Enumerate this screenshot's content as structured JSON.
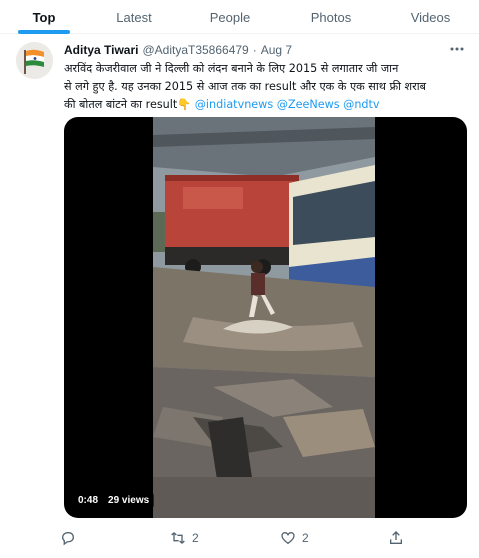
{
  "tabs": [
    {
      "label": "Top",
      "active": true
    },
    {
      "label": "Latest",
      "active": false
    },
    {
      "label": "People",
      "active": false
    },
    {
      "label": "Photos",
      "active": false
    },
    {
      "label": "Videos",
      "active": false
    }
  ],
  "tweet": {
    "display_name": "Aditya Tiwari",
    "handle": "@AdityaT35866479",
    "separator": "·",
    "date": "Aug 7",
    "text_line1": "अरविंद केजरीवाल जी ने दिल्ली को लंदन बनाने के लिए 2015 से लगातार जी जान",
    "text_line2": "से लगे हुए है. यह उनका 2015 से आज तक का result और एक के एक साथ फ्री शराब",
    "text_line3": "की बोतल बांटने का result👇 ",
    "mentions": [
      "@indiatvnews",
      "@ZeeNews",
      "@ndtv"
    ],
    "video": {
      "duration": "0:48",
      "views": "29 views"
    },
    "actions": {
      "reply_count": "",
      "retweet_count": "2",
      "like_count": "2"
    }
  },
  "colors": {
    "accent": "#1d9bf0",
    "secondary_text": "#536471",
    "divider": "#eff3f4"
  }
}
